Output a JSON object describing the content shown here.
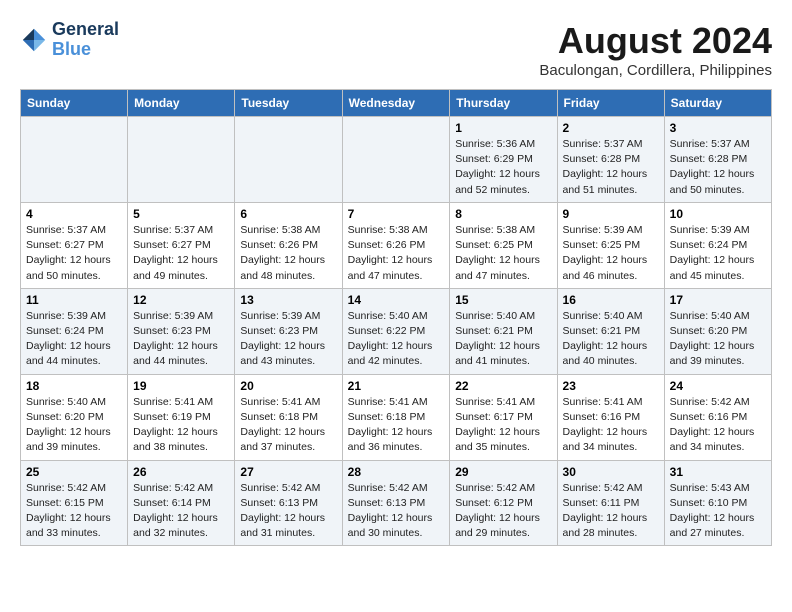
{
  "logo": {
    "line1": "General",
    "line2": "Blue"
  },
  "title": "August 2024",
  "subtitle": "Baculongan, Cordillera, Philippines",
  "days_of_week": [
    "Sunday",
    "Monday",
    "Tuesday",
    "Wednesday",
    "Thursday",
    "Friday",
    "Saturday"
  ],
  "weeks": [
    [
      {
        "day": "",
        "sunrise": "",
        "sunset": "",
        "daylight": ""
      },
      {
        "day": "",
        "sunrise": "",
        "sunset": "",
        "daylight": ""
      },
      {
        "day": "",
        "sunrise": "",
        "sunset": "",
        "daylight": ""
      },
      {
        "day": "",
        "sunrise": "",
        "sunset": "",
        "daylight": ""
      },
      {
        "day": "1",
        "sunrise": "Sunrise: 5:36 AM",
        "sunset": "Sunset: 6:29 PM",
        "daylight": "Daylight: 12 hours and 52 minutes."
      },
      {
        "day": "2",
        "sunrise": "Sunrise: 5:37 AM",
        "sunset": "Sunset: 6:28 PM",
        "daylight": "Daylight: 12 hours and 51 minutes."
      },
      {
        "day": "3",
        "sunrise": "Sunrise: 5:37 AM",
        "sunset": "Sunset: 6:28 PM",
        "daylight": "Daylight: 12 hours and 50 minutes."
      }
    ],
    [
      {
        "day": "4",
        "sunrise": "Sunrise: 5:37 AM",
        "sunset": "Sunset: 6:27 PM",
        "daylight": "Daylight: 12 hours and 50 minutes."
      },
      {
        "day": "5",
        "sunrise": "Sunrise: 5:37 AM",
        "sunset": "Sunset: 6:27 PM",
        "daylight": "Daylight: 12 hours and 49 minutes."
      },
      {
        "day": "6",
        "sunrise": "Sunrise: 5:38 AM",
        "sunset": "Sunset: 6:26 PM",
        "daylight": "Daylight: 12 hours and 48 minutes."
      },
      {
        "day": "7",
        "sunrise": "Sunrise: 5:38 AM",
        "sunset": "Sunset: 6:26 PM",
        "daylight": "Daylight: 12 hours and 47 minutes."
      },
      {
        "day": "8",
        "sunrise": "Sunrise: 5:38 AM",
        "sunset": "Sunset: 6:25 PM",
        "daylight": "Daylight: 12 hours and 47 minutes."
      },
      {
        "day": "9",
        "sunrise": "Sunrise: 5:39 AM",
        "sunset": "Sunset: 6:25 PM",
        "daylight": "Daylight: 12 hours and 46 minutes."
      },
      {
        "day": "10",
        "sunrise": "Sunrise: 5:39 AM",
        "sunset": "Sunset: 6:24 PM",
        "daylight": "Daylight: 12 hours and 45 minutes."
      }
    ],
    [
      {
        "day": "11",
        "sunrise": "Sunrise: 5:39 AM",
        "sunset": "Sunset: 6:24 PM",
        "daylight": "Daylight: 12 hours and 44 minutes."
      },
      {
        "day": "12",
        "sunrise": "Sunrise: 5:39 AM",
        "sunset": "Sunset: 6:23 PM",
        "daylight": "Daylight: 12 hours and 44 minutes."
      },
      {
        "day": "13",
        "sunrise": "Sunrise: 5:39 AM",
        "sunset": "Sunset: 6:23 PM",
        "daylight": "Daylight: 12 hours and 43 minutes."
      },
      {
        "day": "14",
        "sunrise": "Sunrise: 5:40 AM",
        "sunset": "Sunset: 6:22 PM",
        "daylight": "Daylight: 12 hours and 42 minutes."
      },
      {
        "day": "15",
        "sunrise": "Sunrise: 5:40 AM",
        "sunset": "Sunset: 6:21 PM",
        "daylight": "Daylight: 12 hours and 41 minutes."
      },
      {
        "day": "16",
        "sunrise": "Sunrise: 5:40 AM",
        "sunset": "Sunset: 6:21 PM",
        "daylight": "Daylight: 12 hours and 40 minutes."
      },
      {
        "day": "17",
        "sunrise": "Sunrise: 5:40 AM",
        "sunset": "Sunset: 6:20 PM",
        "daylight": "Daylight: 12 hours and 39 minutes."
      }
    ],
    [
      {
        "day": "18",
        "sunrise": "Sunrise: 5:40 AM",
        "sunset": "Sunset: 6:20 PM",
        "daylight": "Daylight: 12 hours and 39 minutes."
      },
      {
        "day": "19",
        "sunrise": "Sunrise: 5:41 AM",
        "sunset": "Sunset: 6:19 PM",
        "daylight": "Daylight: 12 hours and 38 minutes."
      },
      {
        "day": "20",
        "sunrise": "Sunrise: 5:41 AM",
        "sunset": "Sunset: 6:18 PM",
        "daylight": "Daylight: 12 hours and 37 minutes."
      },
      {
        "day": "21",
        "sunrise": "Sunrise: 5:41 AM",
        "sunset": "Sunset: 6:18 PM",
        "daylight": "Daylight: 12 hours and 36 minutes."
      },
      {
        "day": "22",
        "sunrise": "Sunrise: 5:41 AM",
        "sunset": "Sunset: 6:17 PM",
        "daylight": "Daylight: 12 hours and 35 minutes."
      },
      {
        "day": "23",
        "sunrise": "Sunrise: 5:41 AM",
        "sunset": "Sunset: 6:16 PM",
        "daylight": "Daylight: 12 hours and 34 minutes."
      },
      {
        "day": "24",
        "sunrise": "Sunrise: 5:42 AM",
        "sunset": "Sunset: 6:16 PM",
        "daylight": "Daylight: 12 hours and 34 minutes."
      }
    ],
    [
      {
        "day": "25",
        "sunrise": "Sunrise: 5:42 AM",
        "sunset": "Sunset: 6:15 PM",
        "daylight": "Daylight: 12 hours and 33 minutes."
      },
      {
        "day": "26",
        "sunrise": "Sunrise: 5:42 AM",
        "sunset": "Sunset: 6:14 PM",
        "daylight": "Daylight: 12 hours and 32 minutes."
      },
      {
        "day": "27",
        "sunrise": "Sunrise: 5:42 AM",
        "sunset": "Sunset: 6:13 PM",
        "daylight": "Daylight: 12 hours and 31 minutes."
      },
      {
        "day": "28",
        "sunrise": "Sunrise: 5:42 AM",
        "sunset": "Sunset: 6:13 PM",
        "daylight": "Daylight: 12 hours and 30 minutes."
      },
      {
        "day": "29",
        "sunrise": "Sunrise: 5:42 AM",
        "sunset": "Sunset: 6:12 PM",
        "daylight": "Daylight: 12 hours and 29 minutes."
      },
      {
        "day": "30",
        "sunrise": "Sunrise: 5:42 AM",
        "sunset": "Sunset: 6:11 PM",
        "daylight": "Daylight: 12 hours and 28 minutes."
      },
      {
        "day": "31",
        "sunrise": "Sunrise: 5:43 AM",
        "sunset": "Sunset: 6:10 PM",
        "daylight": "Daylight: 12 hours and 27 minutes."
      }
    ]
  ]
}
